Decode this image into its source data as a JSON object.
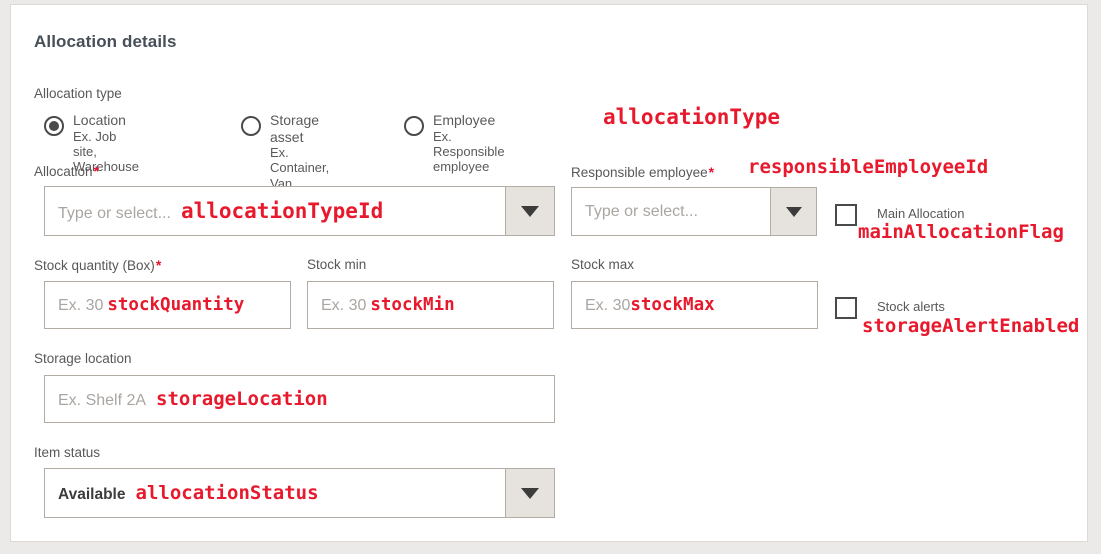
{
  "page": {
    "title": "Allocation details"
  },
  "allocation_type": {
    "label": "Allocation type",
    "annotation": "allocationType",
    "options": [
      {
        "title": "Location",
        "subtitle": "Ex. Job site, Warehouse",
        "selected": true
      },
      {
        "title": "Storage asset",
        "subtitle": "Ex. Container, Van",
        "selected": false
      },
      {
        "title": "Employee",
        "subtitle": "Ex. Responsible employee",
        "selected": false
      }
    ]
  },
  "allocation": {
    "label": "Allocation",
    "required": "*",
    "placeholder": "Type or select...",
    "annotation": "allocationTypeId"
  },
  "responsible_employee": {
    "label": "Responsible employee",
    "required": "*",
    "placeholder": "Type or select...",
    "annotation": "responsibleEmployeeId"
  },
  "main_allocation": {
    "label": "Main Allocation",
    "annotation": "mainAllocationFlag",
    "checked": false
  },
  "stock_quantity": {
    "label": "Stock quantity (Box)",
    "required": "*",
    "placeholder": "Ex. 30",
    "annotation": "stockQuantity"
  },
  "stock_min": {
    "label": "Stock min",
    "placeholder": "Ex. 30",
    "annotation": "stockMin"
  },
  "stock_max": {
    "label": "Stock max",
    "placeholder": "Ex. 30",
    "annotation": "stockMax"
  },
  "stock_alerts": {
    "label": "Stock alerts",
    "annotation": "storageAlertEnabled",
    "checked": false
  },
  "storage_location": {
    "label": "Storage location",
    "placeholder": "Ex. Shelf 2A",
    "annotation": "storageLocation"
  },
  "item_status": {
    "label": "Item status",
    "value": "Available",
    "annotation": "allocationStatus"
  },
  "colors": {
    "annotation_red": "#e8192c",
    "required_red": "#e8112d",
    "label_gray": "#585858",
    "title_gray": "#474f58",
    "border_gray": "#b3aca4",
    "dropdown_fill": "#e6e3df",
    "page_background": "#eceae8"
  }
}
